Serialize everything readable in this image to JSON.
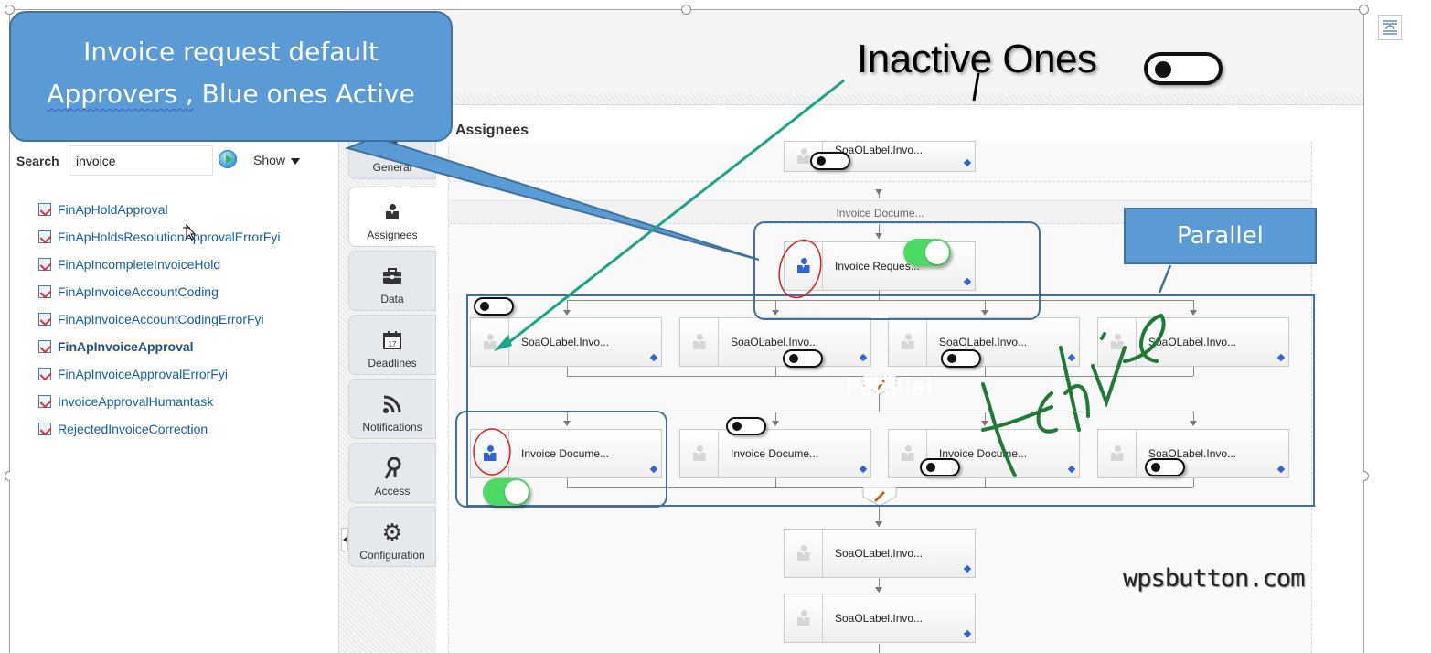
{
  "callout": {
    "line1": "Invoice request default",
    "line2_underlined": "Approvers ,",
    "line2_rest": " Blue ones Active"
  },
  "annotations": {
    "inactive_title": "Inactive Ones",
    "parallel_box": "Parallel",
    "parallel_ghost_label": "Parallel",
    "handwritten_active": "Active",
    "watermark": "wpsbutton.com"
  },
  "left_pane": {
    "search_label": "Search",
    "search_value": "invoice",
    "show_label": "Show",
    "tasks": [
      {
        "label": "FinApHoldApproval",
        "selected": false
      },
      {
        "label": "FinApHoldsResolutionApprovalErrorFyi",
        "selected": false
      },
      {
        "label": "FinApIncompleteInvoiceHold",
        "selected": false
      },
      {
        "label": "FinApInvoiceAccountCoding",
        "selected": false
      },
      {
        "label": "FinApInvoiceAccountCodingErrorFyi",
        "selected": false
      },
      {
        "label": "FinApInvoiceApproval",
        "selected": true
      },
      {
        "label": "FinApInvoiceApprovalErrorFyi",
        "selected": false
      },
      {
        "label": "InvoiceApprovalHumantask",
        "selected": false
      },
      {
        "label": "RejectedInvoiceCorrection",
        "selected": false
      }
    ]
  },
  "tabs": [
    {
      "label": "General",
      "icon": "general-icon",
      "active": false
    },
    {
      "label": "Assignees",
      "icon": "user-icon",
      "active": true
    },
    {
      "label": "Data",
      "icon": "briefcase-icon",
      "active": false
    },
    {
      "label": "Deadlines",
      "icon": "calendar-icon",
      "active": false,
      "icon_text": "17"
    },
    {
      "label": "Notifications",
      "icon": "rss-icon",
      "active": false
    },
    {
      "label": "Access",
      "icon": "keys-icon",
      "active": false
    },
    {
      "label": "Configuration",
      "icon": "gear-icon",
      "active": false
    }
  ],
  "main": {
    "title": "Assignees",
    "stage_header": "Invoice Docume...",
    "nodes": {
      "top": {
        "label": "SoaOLabel.Invo...",
        "icon": "user-icon",
        "active": false
      },
      "invoice_request": {
        "label": "Invoice Reques...",
        "icon": "user-icon",
        "active": true
      },
      "row1": [
        {
          "label": "SoaOLabel.Invo...",
          "icon": "group-icon",
          "active": false
        },
        {
          "label": "SoaOLabel.Invo...",
          "icon": "user-icon",
          "active": false
        },
        {
          "label": "SoaOLabel.Invo...",
          "icon": "supervisor-icon",
          "active": false
        },
        {
          "label": "SoaOLabel.Invo...",
          "icon": "hierarchy-icon",
          "active": false
        }
      ],
      "row2": [
        {
          "label": "Invoice Docume...",
          "icon": "group-icon",
          "active": true
        },
        {
          "label": "Invoice Docume...",
          "icon": "hierarchy-icon",
          "active": false
        },
        {
          "label": "Invoice Docume...",
          "icon": "user-icon",
          "active": false
        },
        {
          "label": "SoaOLabel.Invo...",
          "icon": "supervisor-icon",
          "active": false
        }
      ],
      "bottom": [
        {
          "label": "SoaOLabel.Invo...",
          "icon": "hierarchy-icon",
          "active": false
        },
        {
          "label": "SoaOLabel.Invo...",
          "icon": "user-icon",
          "active": false
        }
      ]
    }
  },
  "colors": {
    "callout_fill": "#5b9bd5",
    "callout_border": "#41719c",
    "toggle_on": "#4cd964",
    "arrow_teal": "#1aa58a",
    "handwriting_green": "#1e7b34",
    "circle_red": "#e02020",
    "link_blue": "#145ea8"
  }
}
